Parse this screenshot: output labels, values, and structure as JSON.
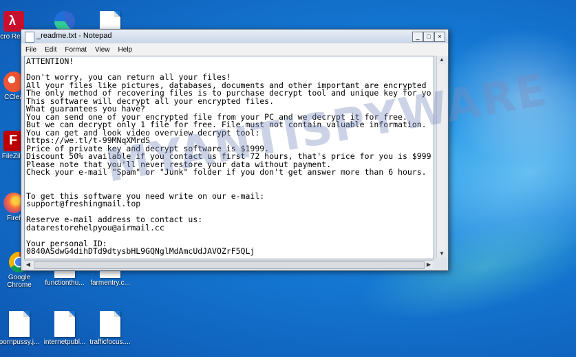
{
  "window": {
    "title": "_readme.txt - Notepad",
    "minimize": "_",
    "maximize": "□",
    "close": "×"
  },
  "menu": [
    "File",
    "Edit",
    "Format",
    "View",
    "Help"
  ],
  "note_text": "ATTENTION!\n\nDon't worry, you can return all your files!\nAll your files like pictures, databases, documents and other important are encrypted\nThe only method of recovering files is to purchase decrypt tool and unique key for yo\nThis software will decrypt all your encrypted files.\nWhat guarantees you have?\nYou can send one of your encrypted file from your PC and we decrypt it for free.\nBut we can decrypt only 1 file for free. File must not contain valuable information.\nYou can get and look video overview decrypt tool:\nhttps://we.tl/t-99MNqXMrdS\nPrice of private key and decrypt software is $1999.\nDiscount 50% available if you contact us first 72 hours, that's price for you is $999\nPlease note that you'll never restore your data without payment.\nCheck your e-mail \"Spam\" or \"Junk\" folder if you don't get answer more than 6 hours.\n\n\nTo get this software you need write on our e-mail:\nsupport@freshingmail.top\n\nReserve e-mail address to contact us:\ndatarestorehelpyou@airmail.cc\n\nYour personal ID:\n0840ASdwG4dihDTd9dtysbHL9GQNglMdAmcUdJAVOZrF5QLj",
  "watermark": "MYANTISPYWARE",
  "desktop_icons": [
    {
      "label": "Acro Reade",
      "icon": "acrobat-reader-icon"
    },
    {
      "label": "CClea",
      "icon": "ccleaner-icon"
    },
    {
      "label": "FileZilla",
      "icon": "filezilla-icon"
    },
    {
      "label": "Firef",
      "icon": "firefox-icon"
    },
    {
      "label": "Google Chrome",
      "icon": "chrome-icon"
    },
    {
      "label": "functionthu...",
      "icon": "file-icon"
    },
    {
      "label": "farmentry.c...",
      "icon": "file-icon"
    },
    {
      "label": "pornpussy.j...",
      "icon": "file-icon"
    },
    {
      "label": "internetpubl...",
      "icon": "file-icon"
    },
    {
      "label": "trafficfocus....",
      "icon": "file-icon"
    }
  ],
  "colors": {
    "desktop": "#1477d2",
    "titlebar": "#c9d6e6"
  }
}
